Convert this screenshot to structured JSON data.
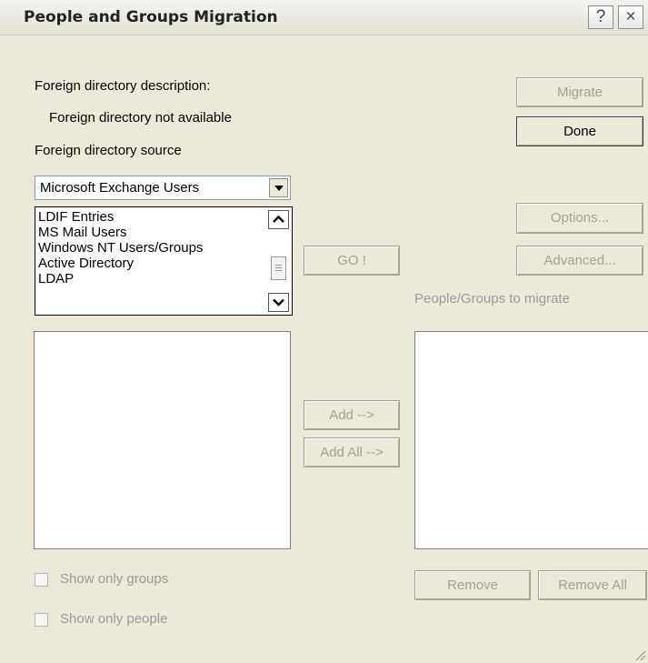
{
  "window": {
    "title": "People and Groups Migration",
    "help": "?",
    "close": "×"
  },
  "labels": {
    "desc": "Foreign directory description:",
    "desc_value": "Foreign directory not available",
    "source": "Foreign directory source",
    "people_groups": "People/Groups to migrate"
  },
  "source_select": {
    "selected": "Microsoft Exchange Users"
  },
  "source_list": {
    "items": [
      "LDIF Entries",
      "MS Mail Users",
      "Windows NT Users/Groups",
      "Active Directory",
      "LDAP"
    ]
  },
  "buttons": {
    "migrate": "Migrate",
    "done": "Done",
    "options": "Options...",
    "advanced": "Advanced...",
    "go": "GO !",
    "add": "Add -->",
    "add_all": "Add All -->",
    "remove": "Remove",
    "remove_all": "Remove All"
  },
  "checkboxes": {
    "groups": "Show only groups",
    "people": "Show only people"
  }
}
